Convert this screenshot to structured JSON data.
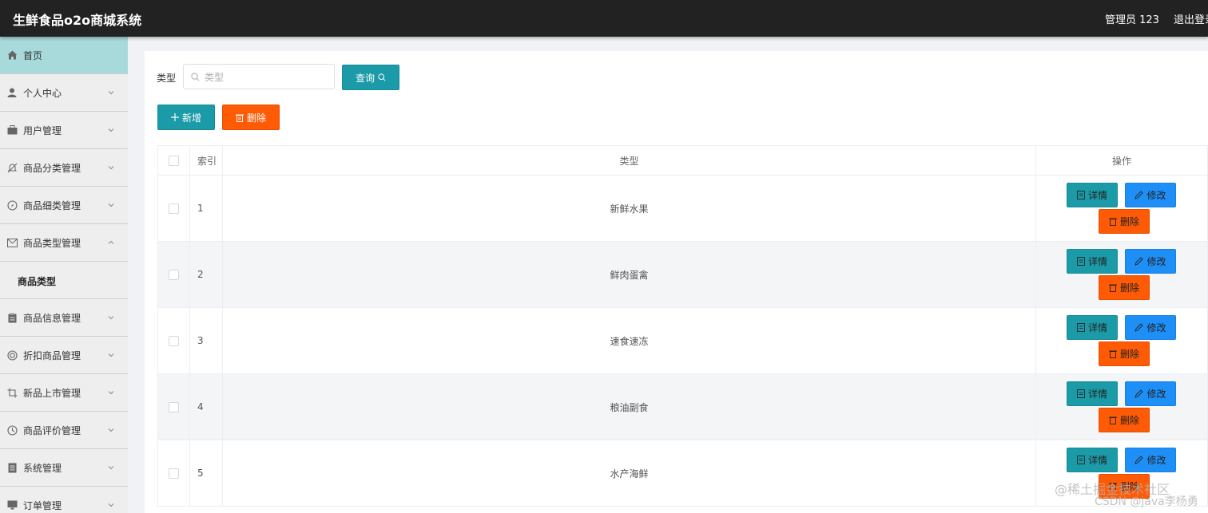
{
  "header": {
    "title": "生鲜食品o2o商城系统",
    "user": "管理员 123",
    "logout": "退出登录"
  },
  "sidebar": {
    "items": [
      {
        "label": "首页",
        "icon": "home-icon",
        "active": true,
        "chevron": false
      },
      {
        "label": "个人中心",
        "icon": "user-icon",
        "chevron": "down"
      },
      {
        "label": "用户管理",
        "icon": "briefcase-icon",
        "chevron": "down"
      },
      {
        "label": "商品分类管理",
        "icon": "bell-off-icon",
        "chevron": "down"
      },
      {
        "label": "商品细类管理",
        "icon": "compass-icon",
        "chevron": "down"
      },
      {
        "label": "商品类型管理",
        "icon": "message-icon",
        "chevron": "up"
      },
      {
        "label": "商品信息管理",
        "icon": "clipboard-icon",
        "chevron": "down"
      },
      {
        "label": "折扣商品管理",
        "icon": "target-icon",
        "chevron": "down"
      },
      {
        "label": "新品上市管理",
        "icon": "crop-icon",
        "chevron": "down"
      },
      {
        "label": "商品评价管理",
        "icon": "clock-icon",
        "chevron": "down"
      },
      {
        "label": "系统管理",
        "icon": "document-icon",
        "chevron": "down"
      },
      {
        "label": "订单管理",
        "icon": "monitor-icon",
        "chevron": "down"
      }
    ],
    "submenu": "商品类型"
  },
  "search": {
    "label": "类型",
    "placeholder": "类型",
    "query_button": "查询"
  },
  "actions": {
    "add": "新增",
    "delete": "删除"
  },
  "table": {
    "headers": {
      "index": "索引",
      "type": "类型",
      "ops": "操作"
    },
    "rows": [
      {
        "index": "1",
        "type": "新鲜水果"
      },
      {
        "index": "2",
        "type": "鲜肉蛋禽"
      },
      {
        "index": "3",
        "type": "速食速冻"
      },
      {
        "index": "4",
        "type": "粮油副食"
      },
      {
        "index": "5",
        "type": "水产海鲜"
      }
    ],
    "row_buttons": {
      "detail": "详情",
      "edit": "修改",
      "delete": "删除"
    }
  },
  "watermark": {
    "line1": "@稀土掘金技术社区",
    "line2": "CSDN @java李杨勇"
  },
  "colors": {
    "topbar": "#222222",
    "sidebar_active": "#a8dadc",
    "teal": "#1b9aa8",
    "orange": "#ff5a05",
    "blue": "#1e8ff7"
  }
}
